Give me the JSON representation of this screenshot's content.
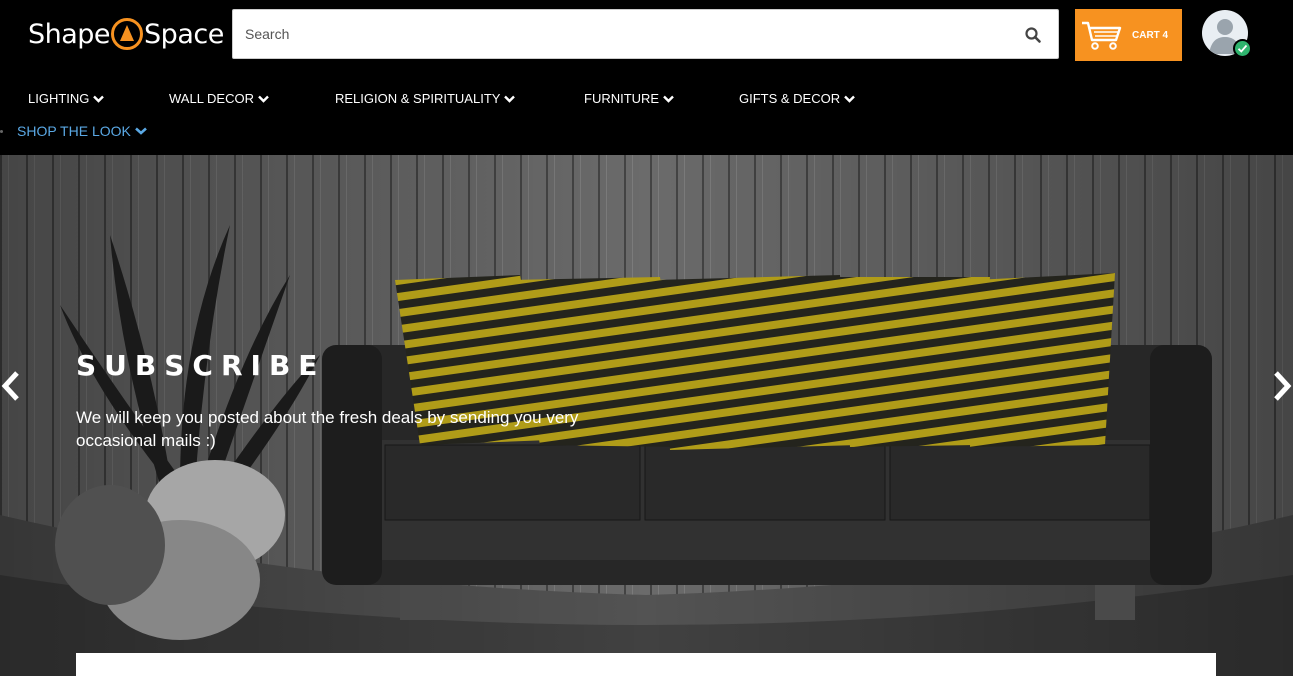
{
  "brand": {
    "name_left": "Shape",
    "name_right": "Space",
    "accent": "#f79220"
  },
  "search": {
    "placeholder": "Search",
    "icon": "search-icon"
  },
  "cart": {
    "label": "CART 4",
    "icon": "cart-icon"
  },
  "user": {
    "icon": "user-avatar-icon",
    "status_icon": "check-icon"
  },
  "nav": {
    "items": [
      {
        "label": "LIGHTING"
      },
      {
        "label": "WALL DECOR"
      },
      {
        "label": "RELIGION & SPIRITUALITY"
      },
      {
        "label": "FURNITURE"
      },
      {
        "label": "GIFTS & DECOR"
      }
    ],
    "secondary": {
      "label": "SHOP THE LOOK"
    },
    "chevron_icon": "chevron-down-icon"
  },
  "hero": {
    "title": "SUBSCRIBE",
    "text": "We will keep you posted about the fresh deals by sending you very occasional mails :)",
    "prev_icon": "chevron-left-icon",
    "next_icon": "chevron-right-icon"
  }
}
